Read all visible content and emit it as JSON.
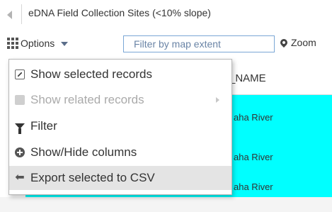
{
  "title_bar": {
    "title": "eDNA Field Collection Sites (<10% slope)"
  },
  "toolbar": {
    "options_label": "Options",
    "filter_label": "Filter by map extent",
    "zoom_label": "Zoom"
  },
  "table": {
    "header": "S_NAME",
    "rows": [
      {
        "value": "aha River"
      },
      {
        "value": "aha River"
      },
      {
        "value": "aha River"
      }
    ],
    "selected_row_color": "#00ffff"
  },
  "menu": {
    "items": [
      {
        "label": "Show selected records",
        "icon": "show-selected-icon",
        "enabled": true
      },
      {
        "label": "Show related records",
        "icon": "related-records-icon",
        "enabled": false,
        "has_submenu": true
      },
      {
        "label": "Filter",
        "icon": "filter-icon",
        "enabled": true
      },
      {
        "label": "Show/Hide columns",
        "icon": "plus-circle-icon",
        "enabled": true
      },
      {
        "label": "Export selected to CSV",
        "icon": "export-icon",
        "enabled": true,
        "highlighted": true
      }
    ]
  }
}
